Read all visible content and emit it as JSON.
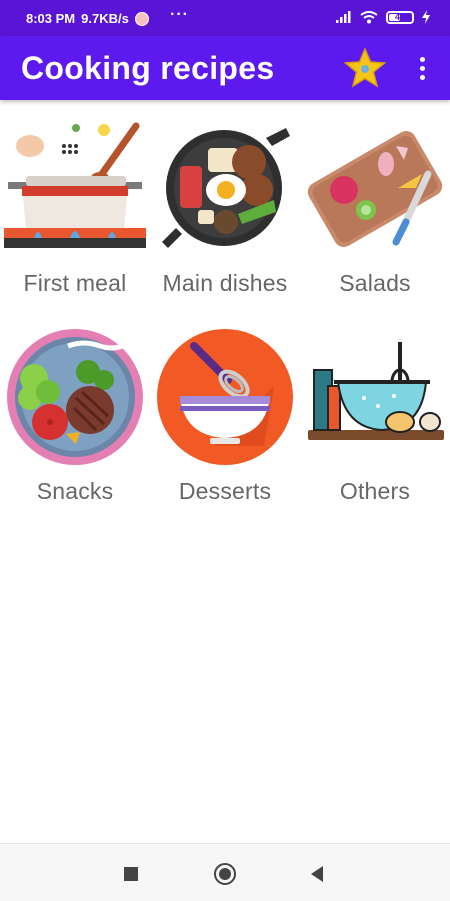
{
  "status_bar": {
    "time": "8:03 PM",
    "speed": "9.7KB/s",
    "more": "···",
    "battery": "47"
  },
  "app_bar": {
    "title": "Cooking recipes",
    "icons": [
      "star-icon",
      "more-vert-icon"
    ],
    "star_color": "#f5c518"
  },
  "categories": [
    {
      "label": "First meal",
      "icon": "pot-icon"
    },
    {
      "label": "Main dishes",
      "icon": "pan-icon"
    },
    {
      "label": "Salads",
      "icon": "cutting-board-icon"
    },
    {
      "label": "Snacks",
      "icon": "plate-icon"
    },
    {
      "label": "Desserts",
      "icon": "bowl-whisk-icon"
    },
    {
      "label": "Others",
      "icon": "mixing-bowl-icon"
    }
  ],
  "nav_bar": {
    "buttons": [
      "recents-icon",
      "home-icon",
      "back-icon"
    ]
  },
  "colors": {
    "status_bar": "#5a14d6",
    "app_bar": "#5c1aee",
    "label": "#666666"
  }
}
